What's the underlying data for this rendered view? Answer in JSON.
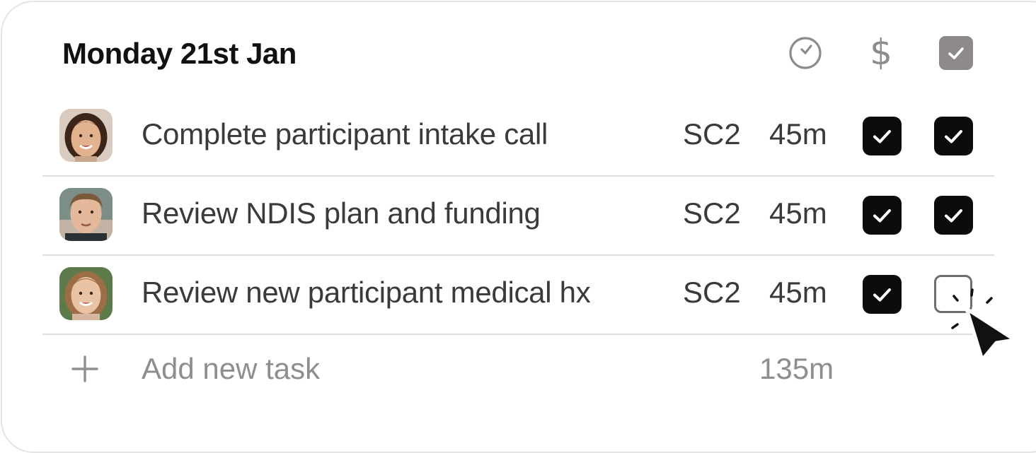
{
  "header": {
    "title": "Monday 21st Jan",
    "icons": [
      "clock-icon",
      "dollar-icon",
      "checkbox-checked-icon"
    ],
    "dollar_glyph": "$"
  },
  "tasks": [
    {
      "label": "Complete participant intake call",
      "code": "SC2",
      "duration": "45m",
      "billed": true,
      "done": true,
      "avatar": "avatar-girl-dark-hair"
    },
    {
      "label": "Review NDIS plan and funding",
      "code": "SC2",
      "duration": "45m",
      "billed": true,
      "done": true,
      "avatar": "avatar-young-man"
    },
    {
      "label": "Review new participant medical hx",
      "code": "SC2",
      "duration": "45m",
      "billed": true,
      "done": false,
      "avatar": "avatar-woman-light-hair"
    }
  ],
  "add_task": {
    "label": "Add new task",
    "total": "135m"
  },
  "colors": {
    "checked_fill": "#0c0c0c",
    "header_check_fill": "#8d8a89",
    "muted_text": "#8e8e8e",
    "divider": "#dedede"
  }
}
